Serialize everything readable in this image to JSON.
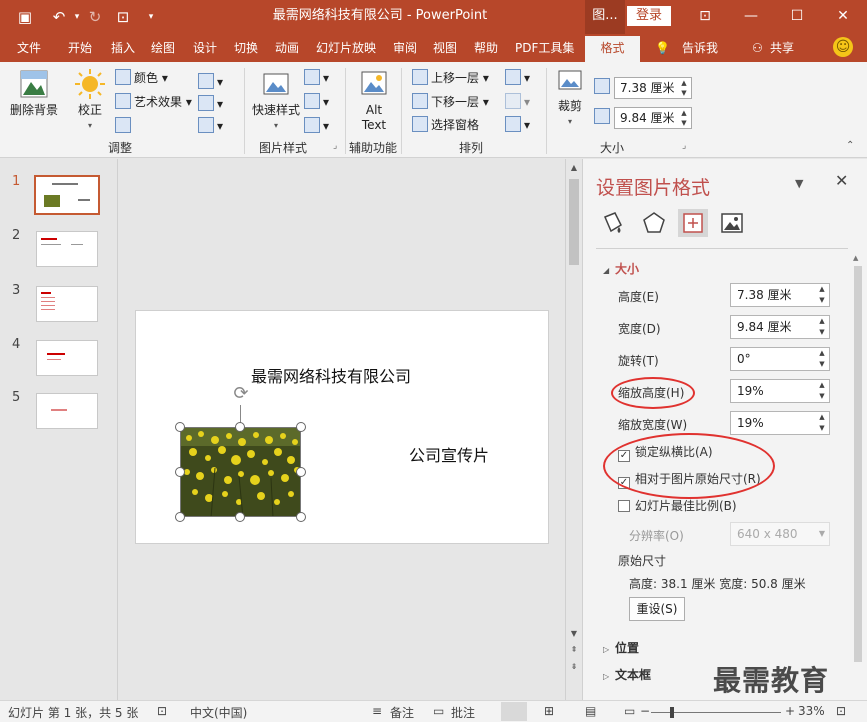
{
  "window": {
    "title": "最需网络科技有限公司 - PowerPoint",
    "context_tab": "图...",
    "login": "登录"
  },
  "ribbon_tabs": [
    "文件",
    "开始",
    "插入",
    "绘图",
    "设计",
    "切换",
    "动画",
    "幻灯片放映",
    "审阅",
    "视图",
    "帮助",
    "PDF工具集",
    "格式",
    "告诉我",
    "共享"
  ],
  "ribbon": {
    "remove_bg": "删除背景",
    "correct": "校正",
    "color": "颜色",
    "art_effects": "艺术效果",
    "group_adjust": "调整",
    "quick_styles": "快速样式",
    "group_pic_styles": "图片样式",
    "alt_text_1": "Alt",
    "alt_text_2": "Text",
    "group_accessibility": "辅助功能",
    "bring_forward": "上移一层",
    "send_backward": "下移一层",
    "selection_pane": "选择窗格",
    "group_arrange": "排列",
    "crop": "裁剪",
    "height": "7.38 厘米",
    "width": "9.84 厘米",
    "group_size": "大小"
  },
  "slides": [
    {
      "num": "1",
      "selected": true
    },
    {
      "num": "2",
      "selected": false
    },
    {
      "num": "3",
      "selected": false
    },
    {
      "num": "4",
      "selected": false
    },
    {
      "num": "5",
      "selected": false
    }
  ],
  "slide": {
    "title": "最需网络科技有限公司",
    "subtitle": "公司宣传片"
  },
  "pane": {
    "title": "设置图片格式",
    "section_size": "大小",
    "height_label": "高度(E)",
    "height_value": "7.38 厘米",
    "width_label": "宽度(D)",
    "width_value": "9.84 厘米",
    "rotation_label": "旋转(T)",
    "rotation_value": "0°",
    "scale_h_label": "缩放高度(H)",
    "scale_h_value": "19%",
    "scale_w_label": "缩放宽度(W)",
    "scale_w_value": "19%",
    "lock_aspect": "锁定纵横比(A)",
    "relative_original": "相对于图片原始尺寸(R)",
    "best_scale": "幻灯片最佳比例(B)",
    "resolution_label": "分辨率(O)",
    "resolution_value": "640 x 480",
    "original_size_label": "原始尺寸",
    "original_size_value": "高度:  38.1 厘米   宽度:  50.8 厘米",
    "reset": "重设(S)",
    "section_position": "位置",
    "section_textbox": "文本框",
    "watermark": "最需教育"
  },
  "statusbar": {
    "slide_info": "幻灯片 第 1 张，共 5 张",
    "language": "中文(中国)",
    "notes": "备注",
    "comments": "批注",
    "zoom": "33%",
    "zoom_level": 0.33
  },
  "colors": {
    "accent": "#b7472a",
    "pane_title": "#c0504d",
    "annotation": "#e0322f"
  }
}
